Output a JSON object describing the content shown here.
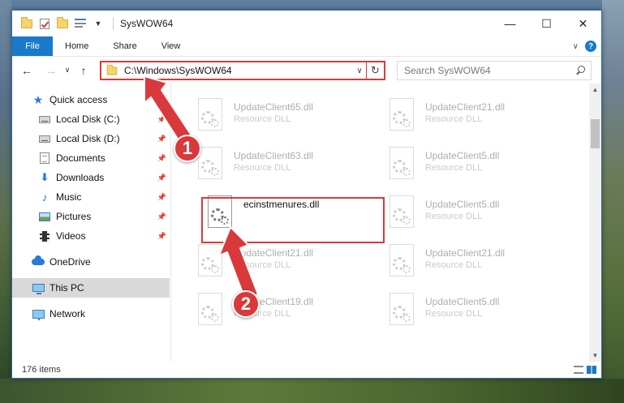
{
  "window": {
    "title": "SysWOW64",
    "controls": {
      "minimize": "—",
      "maximize": "☐",
      "close": "✕"
    }
  },
  "ribbon": {
    "tabs": [
      "File",
      "Home",
      "Share",
      "View"
    ],
    "help": "?"
  },
  "nav": {
    "back": "←",
    "forward": "→",
    "recent": "∨",
    "up": "↑"
  },
  "address": {
    "path": "C:\\Windows\\SysWOW64",
    "dropdown": "∨",
    "refresh": "↻"
  },
  "search": {
    "placeholder": "Search SysWOW64"
  },
  "navpane": {
    "items": [
      {
        "label": "Quick access",
        "icon": "star-icon",
        "pinned": false
      },
      {
        "label": "Local Disk (C:)",
        "icon": "drive-icon",
        "pinned": true
      },
      {
        "label": "Local Disk (D:)",
        "icon": "drive-icon",
        "pinned": true
      },
      {
        "label": "Documents",
        "icon": "documents-icon",
        "pinned": true
      },
      {
        "label": "Downloads",
        "icon": "download-icon",
        "pinned": true
      },
      {
        "label": "Music",
        "icon": "music-icon",
        "pinned": true
      },
      {
        "label": "Pictures",
        "icon": "pictures-icon",
        "pinned": true
      },
      {
        "label": "Videos",
        "icon": "videos-icon",
        "pinned": true
      },
      {
        "label": "OneDrive",
        "icon": "cloud-icon",
        "pinned": false
      },
      {
        "label": "This PC",
        "icon": "computer-icon",
        "pinned": false,
        "selected": true
      },
      {
        "label": "Network",
        "icon": "network-icon",
        "pinned": false
      }
    ],
    "pin_glyph": "📌"
  },
  "files": [
    {
      "name": "UpdateClient65.dll",
      "type": "Resource DLL"
    },
    {
      "name": "UpdateClient21.dll",
      "type": "Resource DLL"
    },
    {
      "name": "UpdateClient63.dll",
      "type": "Resource DLL"
    },
    {
      "name": "UpdateClient5.dll",
      "type": "Resource DLL"
    },
    {
      "name": "ecinstmenures.dll",
      "type": "",
      "highlighted": true
    },
    {
      "name": "UpdateClient5.dll",
      "type": "Resource DLL"
    },
    {
      "name": "UpdateClient21.dll",
      "type": "Resource DLL"
    },
    {
      "name": "UpdateClient21.dll",
      "type": "Resource DLL"
    },
    {
      "name": "UpdateClient19.dll",
      "type": "Resource DLL"
    },
    {
      "name": "UpdateClient5.dll",
      "type": "Resource DLL"
    }
  ],
  "status": {
    "item_count": "176 items"
  },
  "annotations": {
    "badge1": "1",
    "badge2": "2",
    "color": "#d9393b"
  },
  "colors": {
    "accent": "#1979ca",
    "highlight": "#d9393b"
  }
}
